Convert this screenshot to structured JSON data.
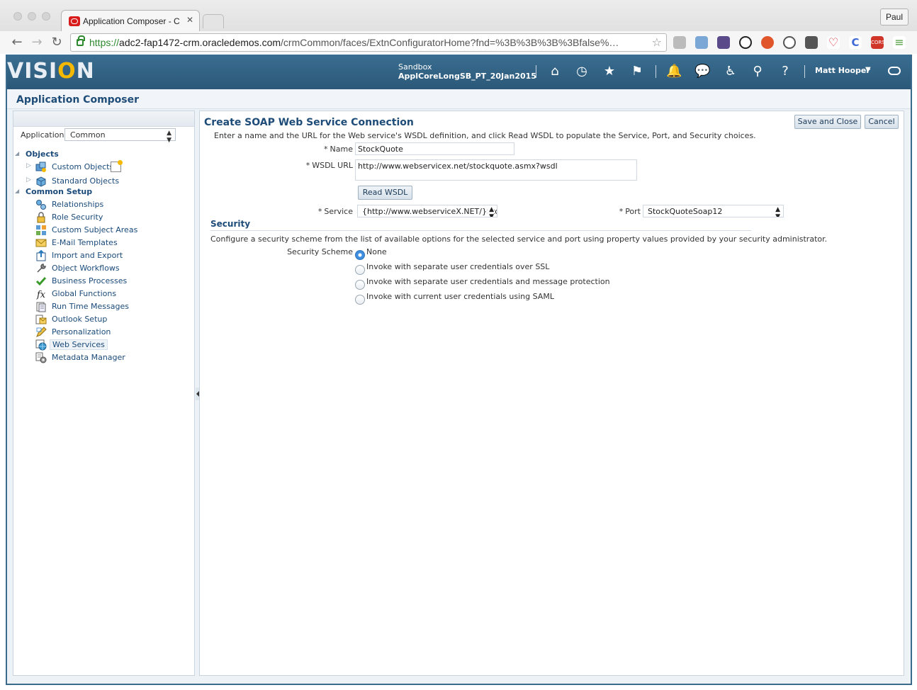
{
  "browser": {
    "tab_title": "Application Composer - C",
    "profile": "Paul",
    "url_scheme": "https://",
    "url_host": "adc2-fap1472-crm.oracledemos.com",
    "url_path": "/crmCommon/faces/ExtnConfiguratorHome?fnd=%3B%3B%3B%3Bfalse%…"
  },
  "header": {
    "logo_pre": "VISI",
    "logo_o": "O",
    "logo_post": "N",
    "sandbox_label": "Sandbox",
    "sandbox_name": "ApplCoreLongSB_PT_20Jan2015",
    "user": "Matt Hooper"
  },
  "app_title": "Application Composer",
  "sidebar": {
    "application_label": "Application",
    "application_value": "Common",
    "sections": [
      {
        "title": "Objects"
      },
      {
        "title": "Common Setup"
      }
    ],
    "objects": [
      {
        "label": "Custom Objects"
      },
      {
        "label": "Standard Objects"
      }
    ],
    "setup_items": [
      {
        "label": "Relationships"
      },
      {
        "label": "Role Security"
      },
      {
        "label": "Custom Subject Areas"
      },
      {
        "label": "E-Mail Templates"
      },
      {
        "label": "Import and Export"
      },
      {
        "label": "Object Workflows"
      },
      {
        "label": "Business Processes"
      },
      {
        "label": "Global Functions"
      },
      {
        "label": "Run Time Messages"
      },
      {
        "label": "Outlook Setup"
      },
      {
        "label": "Personalization"
      },
      {
        "label": "Web Services"
      },
      {
        "label": "Metadata Manager"
      }
    ]
  },
  "main": {
    "heading": "Create SOAP Web Service Connection",
    "instructions": "Enter a name and the URL for the Web service's WSDL definition, and click Read WSDL to populate the Service, Port, and Security choices.",
    "save_close": "Save and Close",
    "cancel": "Cancel",
    "name_label": "Name",
    "name_value": "StockQuote",
    "wsdl_label": "WSDL URL",
    "wsdl_value": "http://www.webservicex.net/stockquote.asmx?wsdl",
    "read_wsdl": "Read WSDL",
    "service_label": "Service",
    "service_value": "{http://www.webserviceX.NET/}Sto",
    "port_label": "Port",
    "port_value": "StockQuoteSoap12",
    "required_marker": "*",
    "security_title": "Security",
    "security_desc": "Configure a security scheme from the list of available options for the selected service and port using property values provided by your security administrator.",
    "scheme_label": "Security Scheme",
    "schemes": [
      {
        "label": "None",
        "selected": true
      },
      {
        "label": "Invoke with separate user credentials over SSL",
        "selected": false
      },
      {
        "label": "Invoke with separate user credentials and message protection",
        "selected": false
      },
      {
        "label": "Invoke with current user credentials using SAML",
        "selected": false
      }
    ]
  }
}
